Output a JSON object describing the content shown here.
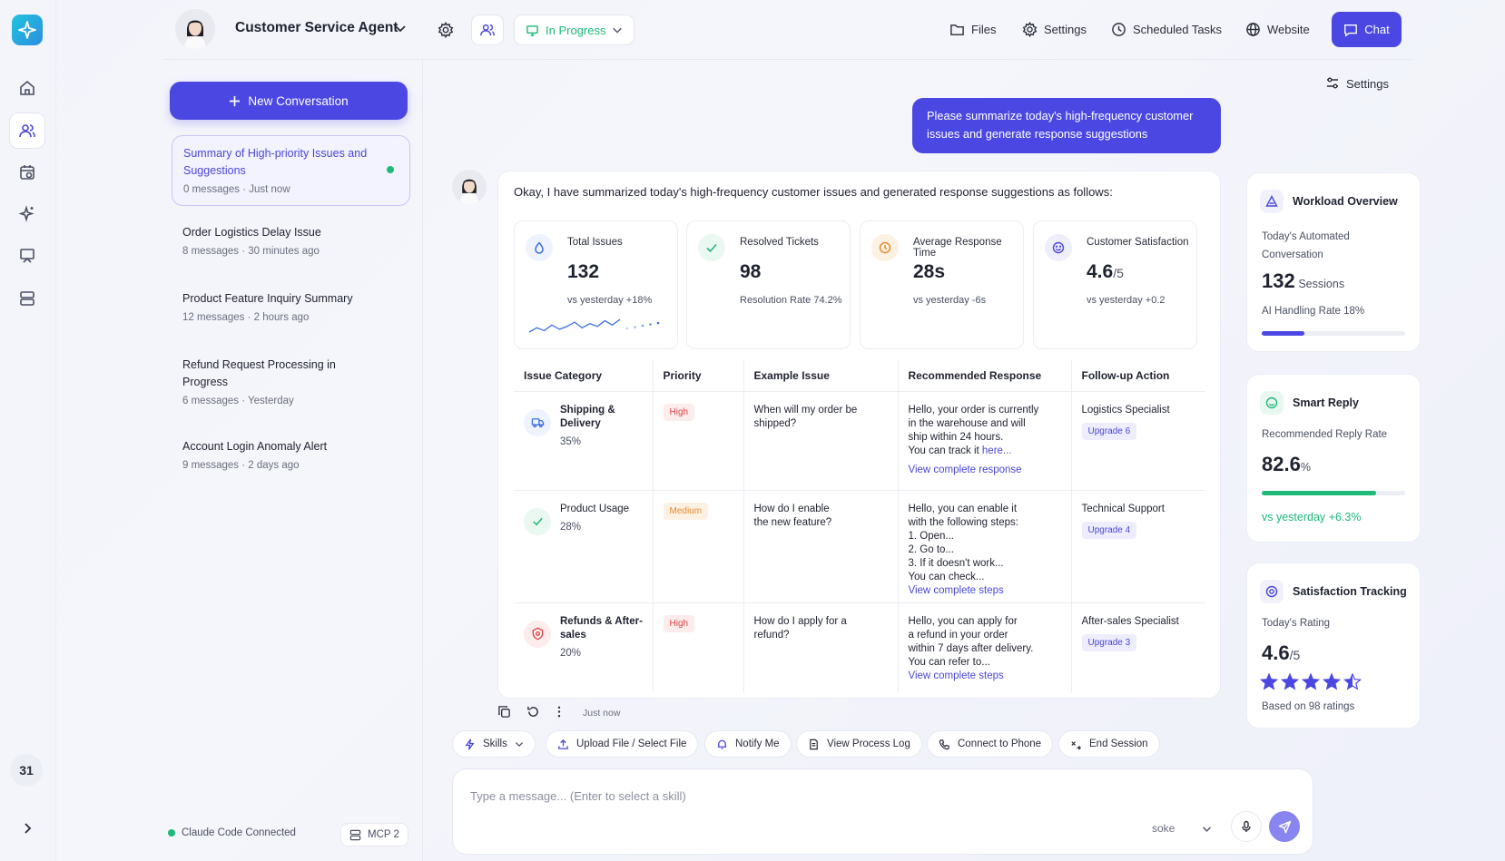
{
  "rail": {
    "calendar_day": "31"
  },
  "header": {
    "agent_name": "Customer Service Agent",
    "status": "In Progress",
    "nav": [
      "Files",
      "Settings",
      "Scheduled Tasks",
      "Website"
    ],
    "chat_label": "Chat"
  },
  "sidebar": {
    "new_conversation": "New Conversation",
    "conversations": [
      {
        "title": "Summary of High-priority Issues and Suggestions",
        "messages": "0 messages",
        "time": "Just now"
      },
      {
        "title": "Order Logistics Delay Issue",
        "messages": "8 messages",
        "time": "30 minutes ago"
      },
      {
        "title": "Product Feature Inquiry Summary",
        "messages": "12 messages",
        "time": "2 hours ago"
      },
      {
        "title": "Refund Request Processing in Progress",
        "messages": "6 messages",
        "time": "Yesterday"
      },
      {
        "title": "Account Login Anomaly Alert",
        "messages": "9 messages",
        "time": "2 days ago"
      }
    ],
    "status_text": "Claude Code Connected",
    "mcp_label": "MCP 2"
  },
  "chat": {
    "settings_label": "Settings",
    "user_message": "Please summarize today's high-frequency customer issues and generate response suggestions",
    "assistant_intro": "Okay, I have summarized today's high-frequency customer issues and generated response suggestions as follows:",
    "stats": [
      {
        "label": "Total Issues",
        "value": "132",
        "unit": "",
        "sub": "vs yesterday +18%"
      },
      {
        "label": "Resolved Tickets",
        "value": "98",
        "unit": "",
        "sub": "Resolution Rate 74.2%"
      },
      {
        "label": "Average Response Time",
        "value": "28s",
        "unit": "",
        "sub": "vs yesterday -6s"
      },
      {
        "label": "Customer Satisfaction",
        "value": "4.6",
        "unit": "/5",
        "sub": "vs yesterday +0.2"
      }
    ],
    "sparkline": [
      5,
      8,
      6,
      10,
      7,
      9,
      12,
      8,
      11,
      9,
      13,
      10,
      14
    ],
    "table": {
      "headers": [
        "Issue Category",
        "Priority",
        "Example Issue",
        "Recommended Response",
        "Follow-up Action"
      ],
      "rows": [
        {
          "category": "Shipping & Delivery",
          "share": "35%",
          "priority": "High",
          "example": "When will my order be shipped?",
          "response": [
            "Hello, your order is currently",
            "in the warehouse and will",
            "ship within 24 hours.",
            "You can track it "
          ],
          "response_link_inline": "here...",
          "response_link": "View complete response",
          "action": "Logistics Specialist",
          "upgrade": "Upgrade  6"
        },
        {
          "category": "Product Usage",
          "share": "28%",
          "priority": "Medium",
          "example": "How do I enable the new feature?",
          "response": [
            "Hello, you can enable it",
            "with the following steps:",
            "1. Open...",
            "2. Go to...",
            "3. If it doesn't work...",
            "You can check..."
          ],
          "response_link_inline": "",
          "response_link": "View complete steps",
          "action": "Technical Support",
          "upgrade": "Upgrade  4"
        },
        {
          "category": "Refunds & After-sales",
          "share": "20%",
          "priority": "High",
          "example": "How do I apply for a refund?",
          "response": [
            "Hello, you can apply for",
            "a refund in your order",
            "within 7 days after delivery.",
            "You can refer to..."
          ],
          "response_link_inline": "",
          "response_link": "View complete steps",
          "action": "After-sales Specialist",
          "upgrade": "Upgrade  3"
        }
      ]
    },
    "message_time": "Just now",
    "skills": [
      "Skills",
      "Upload File / Select File",
      "Notify Me",
      "View Process Log",
      "Connect to Phone",
      "End Session"
    ],
    "input_placeholder": "Type a message...",
    "input_hint": "(Enter to select a skill)",
    "model": "soke"
  },
  "right_panel": {
    "workload": {
      "title": "Workload Overview",
      "label": "Today's Automated Conversation",
      "value": "132",
      "unit": "Sessions",
      "rate_text": "AI Handling Rate 18%",
      "rate": 0.3
    },
    "smart_reply": {
      "title": "Smart Reply",
      "label": "Recommended Reply Rate",
      "value": "82.6",
      "unit": "%",
      "progress": 0.8,
      "trend": "vs yesterday  +6.3%"
    },
    "satisfaction": {
      "title": "Satisfaction Tracking",
      "label": "Today's Rating",
      "value": "4.6",
      "unit": "/5",
      "stars": 4.5,
      "footer": "Based on 98 ratings"
    }
  },
  "colors": {
    "accent": "#4b47e3",
    "success": "#1fb97a",
    "danger": "#e04444",
    "warning": "#e88a2c"
  }
}
